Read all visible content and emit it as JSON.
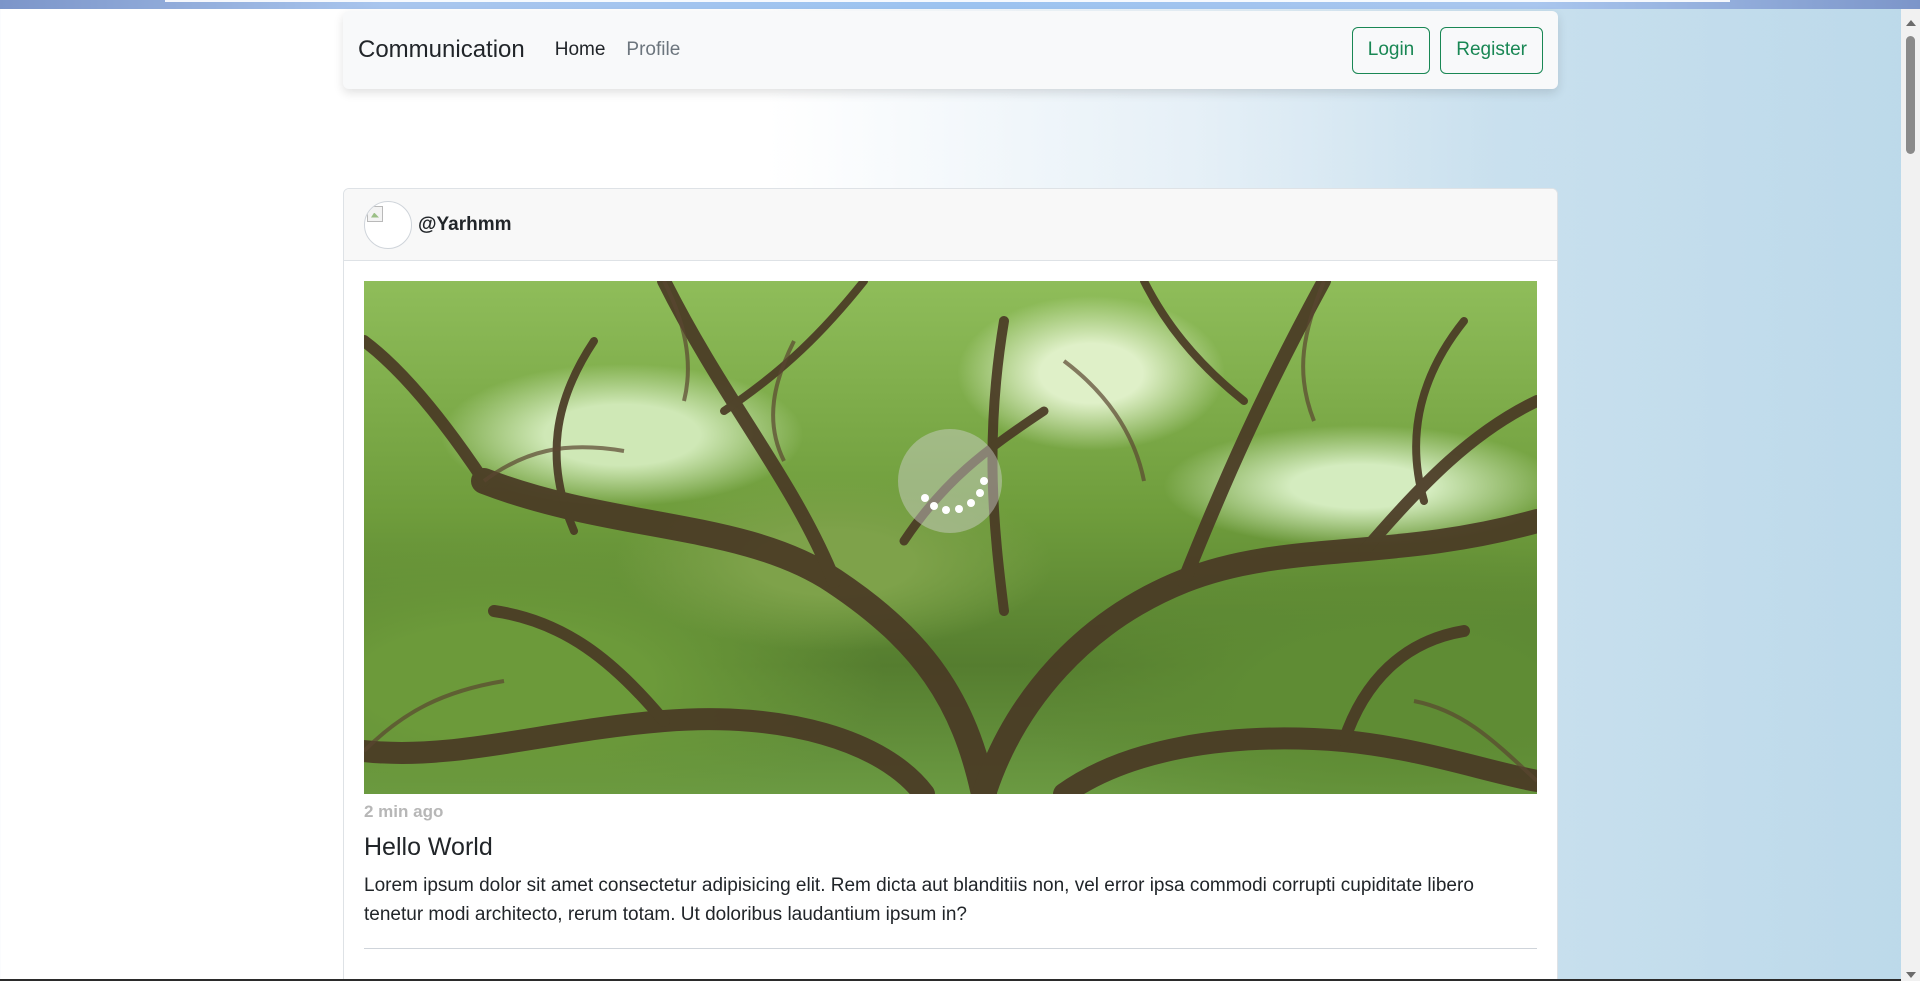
{
  "navbar": {
    "brand": "Communication",
    "links": [
      {
        "label": "Home",
        "active": true
      },
      {
        "label": "Profile",
        "active": false
      }
    ],
    "login_label": "Login",
    "register_label": "Register"
  },
  "post": {
    "avatar_icon": "broken-image-icon",
    "username": "@Yarhmm",
    "timestamp": "2 min ago",
    "title": "Hello World",
    "body": "Lorem ipsum dolor sit amet consectetur adipisicing elit. Rem dicta aut blanditiis non, vel error ipsa commodi corrupti cupiditate libero tenetur modi architecto, rerum totam. Ut doloribus laudantium ipsum in?",
    "image_subject": "tree canopy photo",
    "loading": true
  },
  "colors": {
    "accent": "#198754",
    "muted": "#6c757d",
    "timestamp": "#b7b7b7"
  }
}
